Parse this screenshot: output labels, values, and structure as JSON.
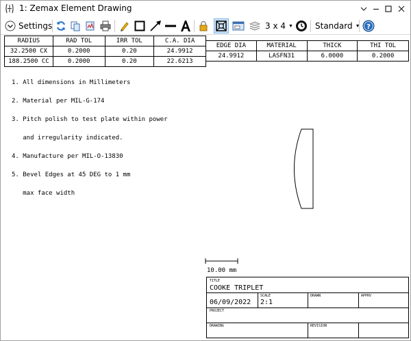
{
  "window": {
    "title": "1: Zemax Element Drawing"
  },
  "toolbar": {
    "settings_label": "Settings",
    "layout_label": "3 x 4",
    "style_label": "Standard",
    "icons": [
      "refresh-icon",
      "copy-icon",
      "export-icon",
      "print-icon",
      "pencil-icon",
      "rectangle-icon",
      "arrow-icon",
      "line-icon",
      "text-icon",
      "lock-icon",
      "fit-icon",
      "window-icon",
      "layers-icon",
      "clock-icon",
      "help-icon"
    ]
  },
  "surface_table": {
    "headers": [
      "RADIUS",
      "RAD TOL",
      "IRR TOL",
      "C.A. DIA"
    ],
    "rows": [
      [
        "32.2500 CX",
        "0.2000",
        "0.20",
        "24.9912"
      ],
      [
        "188.2500 CC",
        "0.2000",
        "0.20",
        "22.6213"
      ]
    ]
  },
  "element_table": {
    "headers": [
      "EDGE DIA",
      "MATERIAL",
      "THICK",
      "THI TOL"
    ],
    "rows": [
      [
        "24.9912",
        "LASFN31",
        "6.0000",
        "0.2000"
      ]
    ]
  },
  "notes": [
    "1. All dimensions in Millimeters",
    "2. Material per MIL-G-174",
    "3. Pitch polish to test plate within power",
    "   and irregularity indicated.",
    "4. Manufacture per MIL-O-13830",
    "5. Bevel Edges at 45 DEG to 1 mm",
    "   max face width"
  ],
  "scale_bar": {
    "label": "10.00 mm"
  },
  "title_block": {
    "title_label": "TITLE",
    "title_value": "COOKE TRIPLET",
    "date_value": "06/09/2022",
    "scale_label": "SCALE",
    "scale_value": "2:1",
    "drawn_label": "DRAWN",
    "apprv_label": "APPRV",
    "project_label": "PROJECT",
    "drawing_label": "DRAWING",
    "revision_label": "REVISION"
  },
  "colors": {
    "accent": "#1e6fcf",
    "pressed_bg": "#cce4f7",
    "help_blue": "#2a6ebb"
  }
}
